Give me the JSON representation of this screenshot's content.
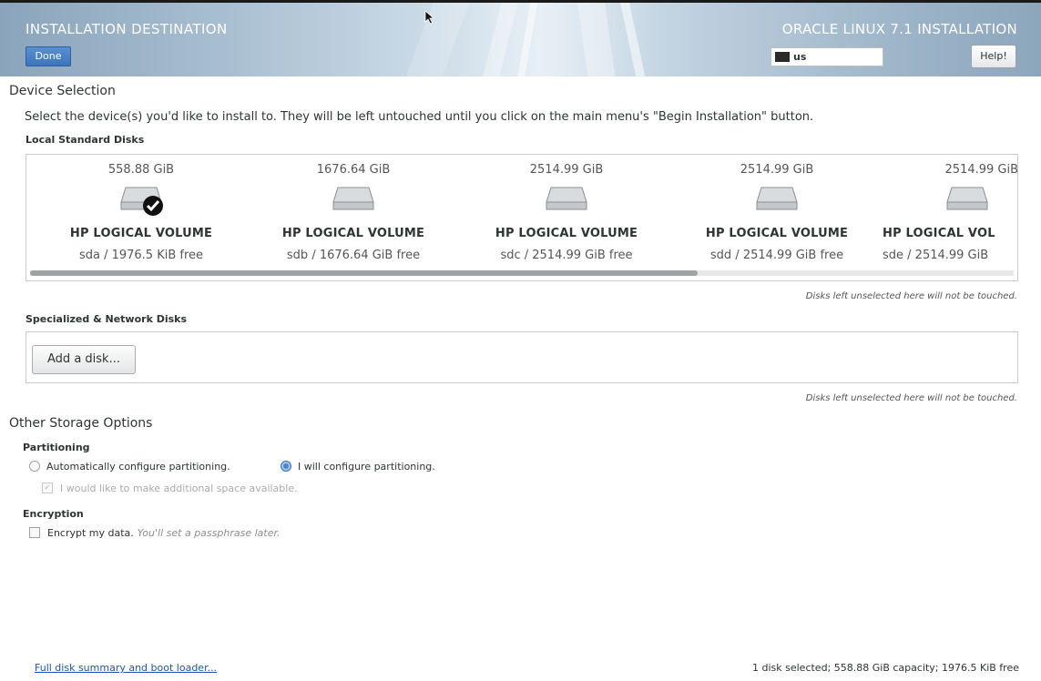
{
  "header": {
    "spoke_title": "INSTALLATION DESTINATION",
    "product_title": "ORACLE LINUX 7.1 INSTALLATION",
    "done_label": "Done",
    "keyboard_layout": "us",
    "help_label": "Help!"
  },
  "device_selection": {
    "title": "Device Selection",
    "description": "Select the device(s) you'd like to install to.  They will be left untouched until you click on the main menu's \"Begin Installation\" button.",
    "local_disks_label": "Local Standard Disks",
    "disks": [
      {
        "size": "558.88 GiB",
        "model": "HP LOGICAL VOLUME",
        "free": "sda  /  1976.5 KiB free",
        "selected": true
      },
      {
        "size": "1676.64 GiB",
        "model": "HP LOGICAL VOLUME",
        "free": "sdb  /  1676.64 GiB free",
        "selected": false
      },
      {
        "size": "2514.99 GiB",
        "model": "HP LOGICAL VOLUME",
        "free": "sdc  /  2514.99 GiB free",
        "selected": false
      },
      {
        "size": "2514.99 GiB",
        "model": "HP LOGICAL VOLUME",
        "free": "sdd  /  2514.99 GiB free",
        "selected": false
      },
      {
        "size": "2514.99 GiB",
        "model": "HP LOGICAL VOL",
        "free": "sde  /  2514.99 GiB",
        "selected": false
      }
    ],
    "local_note": "Disks left unselected here will not be touched.",
    "network_label": "Specialized & Network Disks",
    "add_disk_label": "Add a disk...",
    "network_note": "Disks left unselected here will not be touched."
  },
  "other_storage": {
    "title": "Other Storage Options",
    "partitioning_label": "Partitioning",
    "auto_partition_label": "Automatically configure partitioning.",
    "manual_partition_label": "I will configure partitioning.",
    "additional_space_label": "I would like to make additional space available.",
    "encryption_label": "Encryption",
    "encrypt_label": "Encrypt my data.",
    "encrypt_hint": "You'll set a passphrase later."
  },
  "footer": {
    "summary_link": "Full disk summary and boot loader...",
    "status": "1 disk selected; 558.88 GiB capacity; 1976.5 KiB free"
  },
  "colors": {
    "accent": "#3c74bd",
    "link": "#1c55b5"
  }
}
